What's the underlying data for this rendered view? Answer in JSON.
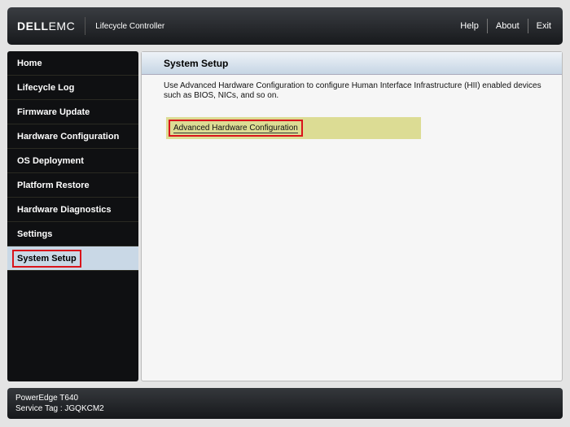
{
  "header": {
    "logo": "DELLEMC",
    "app_title": "Lifecycle Controller",
    "nav": [
      "Help",
      "About",
      "Exit"
    ]
  },
  "sidebar": {
    "items": [
      "Home",
      "Lifecycle Log",
      "Firmware Update",
      "Hardware Configuration",
      "OS Deployment",
      "Platform Restore",
      "Hardware Diagnostics",
      "Settings",
      "System Setup"
    ],
    "selected": "System Setup"
  },
  "main": {
    "title": "System Setup",
    "description": "Use Advanced Hardware Configuration to configure Human Interface Infrastructure (HII) enabled devices such as BIOS, NICs, and so on.",
    "link": "Advanced Hardware Configuration"
  },
  "footer": {
    "model": "PowerEdge T640",
    "service_tag": "Service Tag : JGQKCM2"
  }
}
